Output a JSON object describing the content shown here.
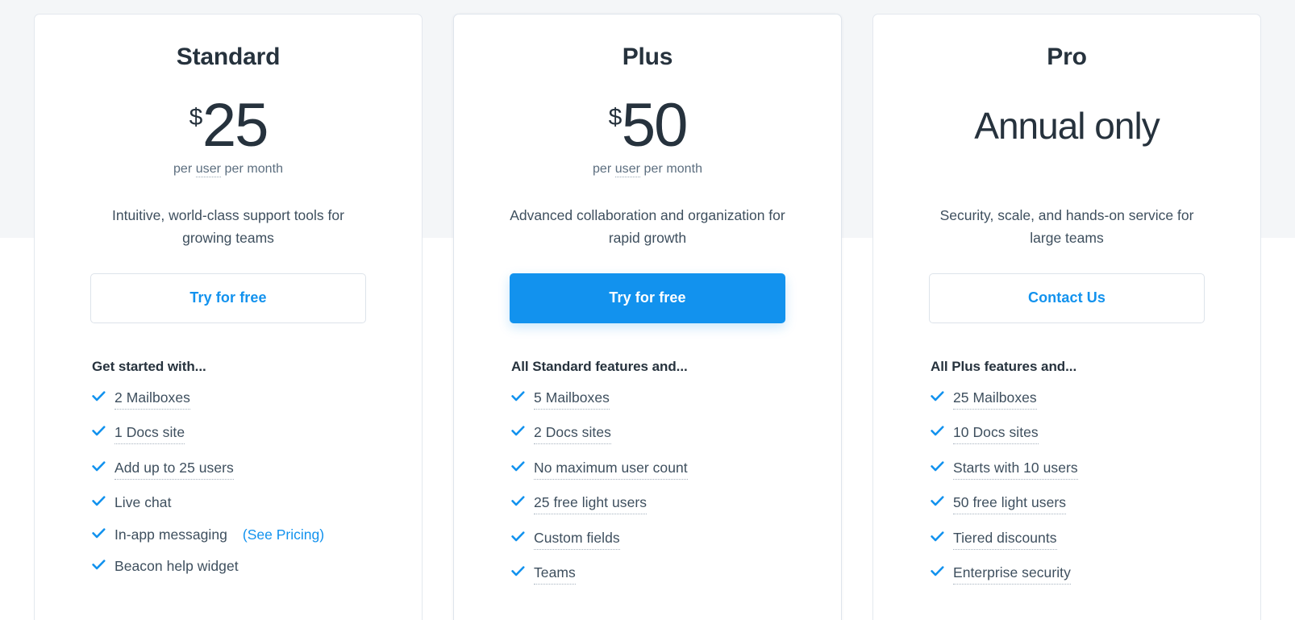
{
  "theme": {
    "accent": "#1292ee",
    "heading_color": "#26323d",
    "body_color": "#3e4f5e",
    "page_bg_top": "#f4f6f8",
    "page_bg_bottom": "#ffffff",
    "card_border": "#e3e8ee"
  },
  "icons": {
    "check": "check-icon"
  },
  "plans": [
    {
      "id": "standard",
      "name": "Standard",
      "featured": false,
      "price": {
        "currency": "$",
        "amount": "25"
      },
      "price_alt": null,
      "price_note_prefix": "per ",
      "price_note_tip": "user",
      "price_note_suffix": " per month",
      "tagline": "Intuitive, world-class support tools for growing teams",
      "cta": {
        "label": "Try for free",
        "style": "outline"
      },
      "features_title": "Get started with...",
      "features": [
        {
          "label": "2 Mailboxes",
          "tooltip": true
        },
        {
          "label": "1 Docs site",
          "tooltip": true
        },
        {
          "label": "Add up to 25 users",
          "tooltip": true
        },
        {
          "label": "Live chat",
          "tooltip": false
        },
        {
          "label": "In-app messaging",
          "tooltip": false,
          "link": "(See Pricing)"
        },
        {
          "label": "Beacon help widget",
          "tooltip": false
        }
      ]
    },
    {
      "id": "plus",
      "name": "Plus",
      "featured": true,
      "price": {
        "currency": "$",
        "amount": "50"
      },
      "price_alt": null,
      "price_note_prefix": "per ",
      "price_note_tip": "user",
      "price_note_suffix": " per month",
      "tagline": "Advanced collaboration and organization for rapid growth",
      "cta": {
        "label": "Try for free",
        "style": "solid"
      },
      "features_title": "All Standard features and...",
      "features": [
        {
          "label": "5 Mailboxes",
          "tooltip": true
        },
        {
          "label": "2 Docs sites",
          "tooltip": true
        },
        {
          "label": "No maximum user count",
          "tooltip": true
        },
        {
          "label": "25 free light users",
          "tooltip": true
        },
        {
          "label": "Custom fields",
          "tooltip": true
        },
        {
          "label": "Teams",
          "tooltip": true
        }
      ]
    },
    {
      "id": "pro",
      "name": "Pro",
      "featured": false,
      "price": null,
      "price_alt": "Annual only",
      "price_note_prefix": "",
      "price_note_tip": "",
      "price_note_suffix": "",
      "tagline": "Security, scale, and hands-on service for large teams",
      "cta": {
        "label": "Contact Us",
        "style": "outline"
      },
      "features_title": "All Plus features and...",
      "features": [
        {
          "label": "25 Mailboxes",
          "tooltip": true
        },
        {
          "label": "10 Docs sites",
          "tooltip": true
        },
        {
          "label": "Starts with 10 users",
          "tooltip": true
        },
        {
          "label": "50 free light users",
          "tooltip": true
        },
        {
          "label": "Tiered discounts",
          "tooltip": true
        },
        {
          "label": "Enterprise security",
          "tooltip": true
        }
      ]
    }
  ]
}
